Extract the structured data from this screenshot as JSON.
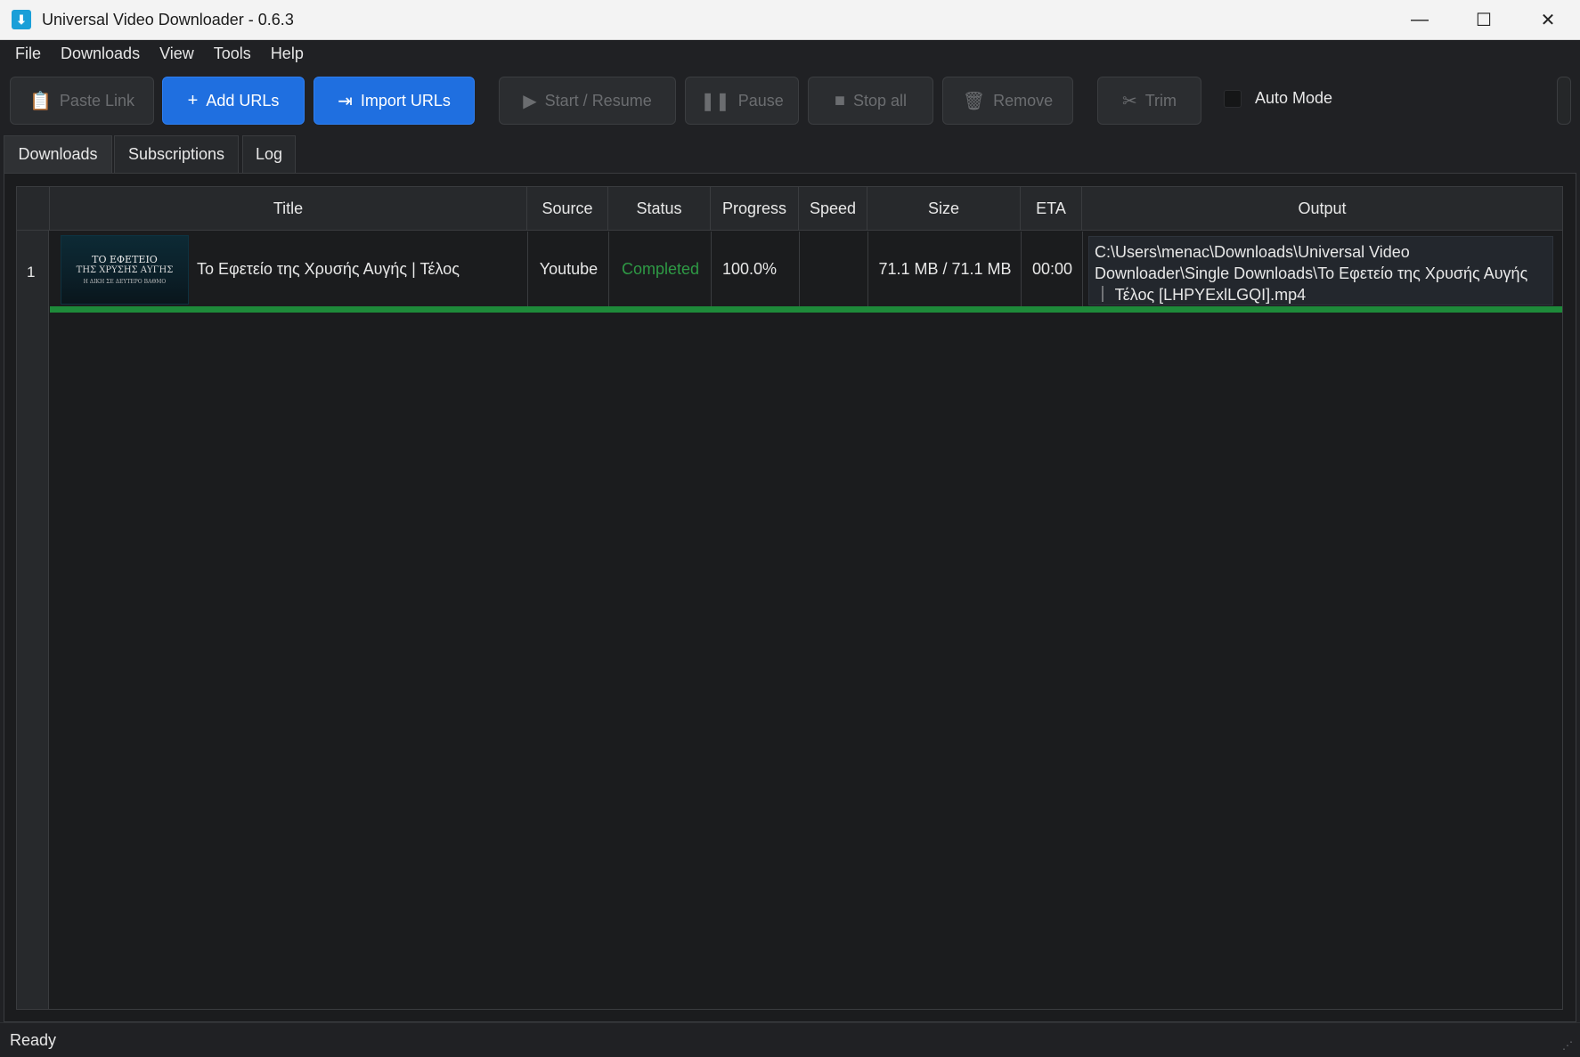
{
  "window": {
    "title": "Universal Video Downloader - 0.6.3",
    "app_icon": "download-icon",
    "minimize": "—",
    "maximize": "☐",
    "close": "✕"
  },
  "menu": {
    "items": [
      "File",
      "Downloads",
      "View",
      "Tools",
      "Help"
    ]
  },
  "toolbar": {
    "paste_link": "Paste Link",
    "add_urls": "Add URLs",
    "import_urls": "Import URLs",
    "start_resume": "Start / Resume",
    "pause": "Pause",
    "stop_all": "Stop all",
    "remove": "Remove",
    "trim": "Trim",
    "auto_mode": "Auto Mode",
    "auto_mode_checked": false,
    "primary_color": "#1f6fe0"
  },
  "tabs": {
    "items": [
      "Downloads",
      "Subscriptions",
      "Log"
    ],
    "active": "Downloads"
  },
  "table": {
    "columns": [
      "Title",
      "Source",
      "Status",
      "Progress",
      "Speed",
      "Size",
      "ETA",
      "Output"
    ],
    "rows": [
      {
        "num": "1",
        "thumb_line1": "ΤΟ ΕΦΕΤΕΙΟ",
        "thumb_line2": "ΤΗΣ ΧΡΥΣΗΣ ΑΥΓΗΣ",
        "thumb_line3": "Η ΔΙΚΗ ΣΕ ΔΕΥΤΕΡΟ ΒΑΘΜΟ",
        "title": "Το Εφετείο της Χρυσής Αυγής | Τέλος",
        "source": "Youtube",
        "status": "Completed",
        "status_color": "#2e9a45",
        "progress": "100.0%",
        "progress_fraction": 1.0,
        "speed": "",
        "size": "71.1 MB / 71.1 MB",
        "eta": "00:00",
        "output": "C:\\Users\\menac\\Downloads\\Universal Video Downloader\\Single Downloads\\Το Εφετείο της Χρυσής Αυγής ｜ Τέλος [LHPYExlLGQI].mp4"
      }
    ]
  },
  "status_bar": {
    "text": "Ready"
  }
}
